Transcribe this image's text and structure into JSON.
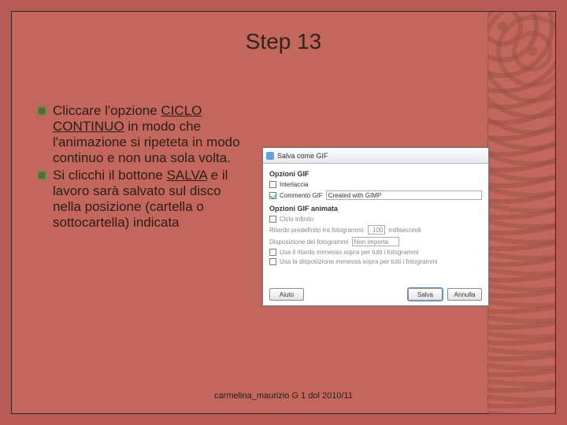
{
  "title": "Step 13",
  "bullets": [
    {
      "pre": "Cliccare l'opzione ",
      "u": "CICLO CONTINUO",
      "post": " in modo che l'animazione si ripeteta in modo continuo e non una sola volta."
    },
    {
      "pre": "Si clicchi il bottone ",
      "u": "SALVA",
      "post": " e il lavoro sarà salvato sul disco nella posizione (cartella o sottocartella) indicata"
    }
  ],
  "footer": "carmelina_maurizio G 1 dol 2010/11",
  "dialog": {
    "title": "Salva come GIF",
    "section1": "Opzioni GIF",
    "opt_interlace": "Interlaccia",
    "opt_comment": "Commento GIF",
    "comment_value": "Created with GIMP",
    "section2": "Opzioni GIF animata",
    "opt_loop": "Ciclo infinito",
    "delay_label": "Ritardo predefinito tra fotogrammi:",
    "delay_value": "100",
    "delay_unit": "millisecondi",
    "dispose_label": "Disposizione dei fotogrammi",
    "dispose_value": "Non importa",
    "cb1": "Usa il ritardo immesso sopra per tutti i fotogrammi",
    "cb2": "Usa la disposizione immessa sopra per tutti i fotogrammi",
    "btn_help": "Aiuto",
    "btn_save": "Salva",
    "btn_cancel": "Annulla"
  }
}
